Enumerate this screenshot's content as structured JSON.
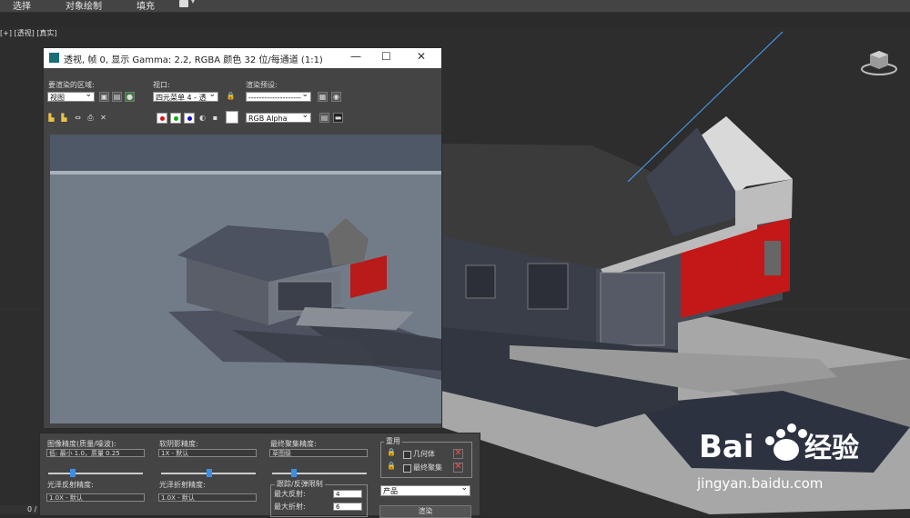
{
  "topbar": {
    "items": [
      "选择",
      "对象绘制",
      "填充"
    ]
  },
  "viewport": {
    "label": "[+] [透视] [真实]"
  },
  "render_window": {
    "title": "透视, 帧 0, 显示 Gamma: 2.2, RGBA 颜色 32 位/每通道 (1:1)",
    "area_label": "要渲染的区域:",
    "area_value": "视图",
    "viewport_label": "视口:",
    "viewport_value": "四元菜单 4 - 透",
    "preset_label": "渲染预设:",
    "preset_value": "--------------------",
    "channel_value": "RGB Alpha"
  },
  "panel": {
    "image_precision_label": "图像精度(质量/噪波):",
    "image_precision_value": "低: 最小 1.0，质量 0.25",
    "soft_shadow_label": "软阴影精度:",
    "soft_shadow_value": "1X - 默认",
    "final_gather_label": "最终聚集精度:",
    "final_gather_value": "草图级",
    "glossy_reflect_label": "光泽反射精度:",
    "glossy_reflect_value": "1.0X - 默认",
    "glossy_refract_label": "光泽折射精度:",
    "glossy_refract_value": "1.0X - 默认",
    "reuse_title": "重用",
    "geometry_label": "几何体",
    "final_gather_reuse_label": "最终聚集",
    "trace_title": "跟踪/反弹限制",
    "max_reflect_label": "最大反射:",
    "max_reflect_value": "4",
    "max_refract_label": "最大折射:",
    "max_refract_value": "6",
    "product_value": "产品",
    "render_label": "渲染"
  },
  "timeline": {
    "value": "0 /"
  },
  "watermark": {
    "url": "jingyan.baidu.com"
  },
  "colors": {
    "accent_blue": "#3a8ee6",
    "red_x": "#ff4a4a",
    "title_bar": "#ffffff",
    "panel_bg": "#444444"
  }
}
